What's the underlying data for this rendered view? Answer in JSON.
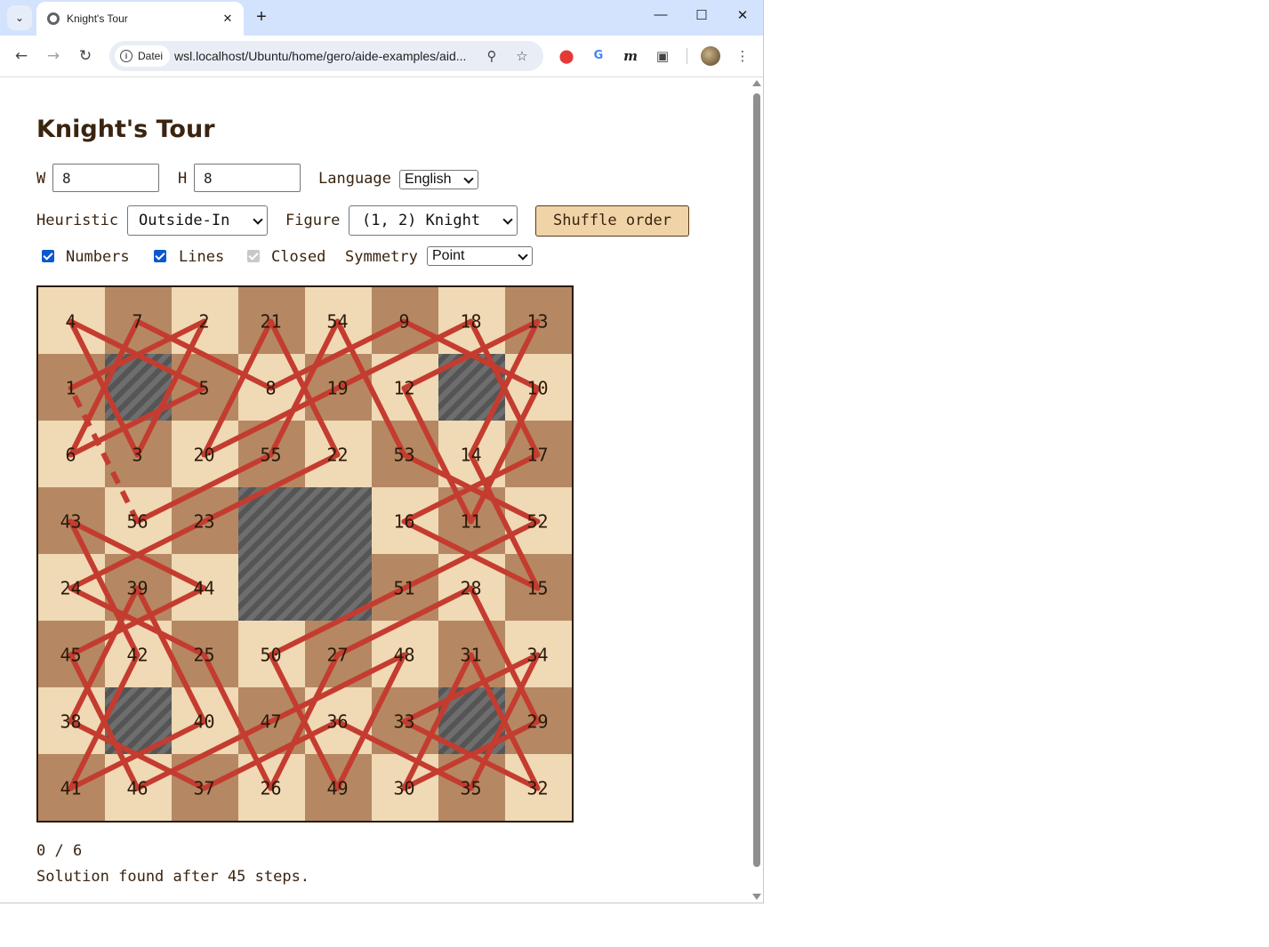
{
  "browser": {
    "tab_title": "Knight's Tour",
    "chip_label": "Datei",
    "url": "wsl.localhost/Ubuntu/home/gero/aide-examples/aid..."
  },
  "page": {
    "title": "Knight's Tour",
    "w_label": "W",
    "w_value": "8",
    "h_label": "H",
    "h_value": "8",
    "language_label": "Language",
    "language_value": "English",
    "heuristic_label": "Heuristic",
    "heuristic_value": "Outside-In",
    "figure_label": "Figure",
    "figure_value": "(1, 2) Knight",
    "shuffle_label": "Shuffle order",
    "numbers_label": "Numbers",
    "numbers_checked": true,
    "lines_label": "Lines",
    "lines_checked": true,
    "closed_label": "Closed",
    "closed_checked": true,
    "symmetry_label": "Symmetry",
    "symmetry_value": "Point",
    "progress": "0 / 6",
    "status": "Solution found after 45 steps."
  },
  "board": {
    "cols": 8,
    "rows": 8,
    "colors": {
      "light": "#f0d9b5",
      "dark": "#b58863",
      "blocked": "#555555",
      "line": "#c43c30",
      "border": "#2b1a0c"
    },
    "blocked": [
      [
        1,
        1
      ],
      [
        6,
        1
      ],
      [
        3,
        3
      ],
      [
        4,
        3
      ],
      [
        3,
        4
      ],
      [
        4,
        4
      ],
      [
        1,
        6
      ],
      [
        6,
        6
      ]
    ],
    "numbers": [
      [
        4,
        7,
        2,
        21,
        54,
        9,
        18,
        13
      ],
      [
        1,
        null,
        5,
        8,
        19,
        12,
        null,
        10
      ],
      [
        6,
        3,
        20,
        55,
        22,
        53,
        14,
        17
      ],
      [
        43,
        56,
        23,
        null,
        null,
        16,
        11,
        52
      ],
      [
        24,
        39,
        44,
        null,
        null,
        51,
        28,
        15
      ],
      [
        45,
        42,
        25,
        50,
        27,
        48,
        31,
        34
      ],
      [
        38,
        null,
        40,
        47,
        36,
        33,
        null,
        29
      ],
      [
        41,
        46,
        37,
        26,
        49,
        30,
        35,
        32
      ]
    ],
    "closing_move_dashed": true
  }
}
